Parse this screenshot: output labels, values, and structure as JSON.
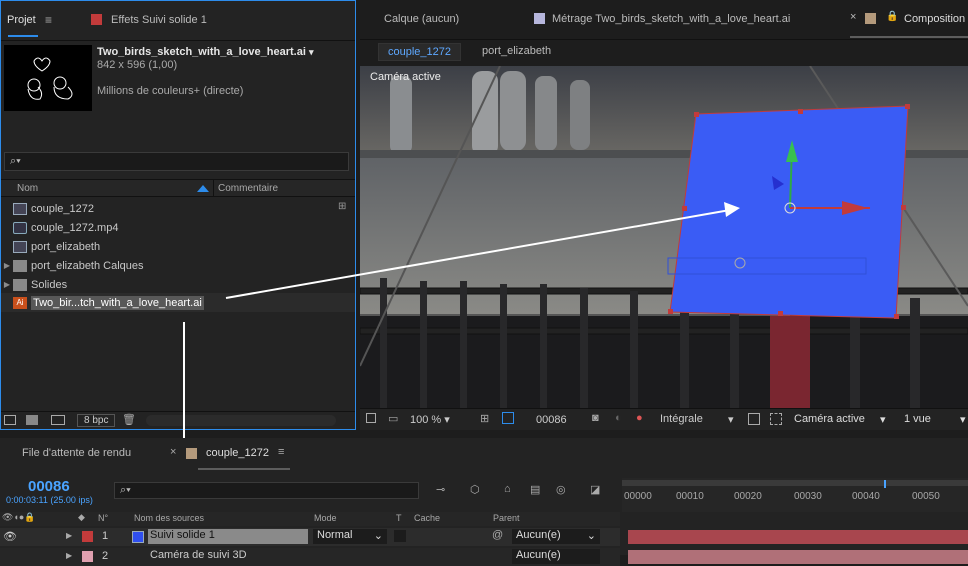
{
  "project_panel": {
    "tab_project": "Projet",
    "tab_effects": "Effets",
    "effects_target": "Suivi solide 1",
    "preview": {
      "name": "Two_birds_sketch_with_a_love_heart.ai",
      "dims": "842 x 596 (1,00)",
      "colors": "Millions de couleurs+ (directe)"
    },
    "search_placeholder": "",
    "col_name": "Nom",
    "col_comment": "Commentaire",
    "items": [
      {
        "label": "couple_1272",
        "kind": "comp"
      },
      {
        "label": "couple_1272.mp4",
        "kind": "footage"
      },
      {
        "label": "port_elizabeth",
        "kind": "comp"
      },
      {
        "label": "port_elizabeth Calques",
        "kind": "folder"
      },
      {
        "label": "Solides",
        "kind": "folder"
      },
      {
        "label": "Two_bir...tch_with_a_love_heart.ai",
        "kind": "ai"
      }
    ],
    "bpc": "8 bpc"
  },
  "viewer_panel": {
    "tab_layer": "Calque",
    "tab_layer_value": "(aucun)",
    "tab_footage": "Métrage",
    "tab_footage_value": "Two_birds_sketch_with_a_love_heart.ai",
    "tab_comp": "Composition",
    "comp_tabs": [
      "couple_1272",
      "port_elizabeth"
    ],
    "camera_label": "Caméra active",
    "zoom": "100 %",
    "timecode": "00086",
    "resolution": "Intégrale",
    "camera_select": "Caméra active",
    "views": "1 vue"
  },
  "timeline": {
    "tab_render": "File d'attente de rendu",
    "tab_comp": "couple_1272",
    "current_time": "00086",
    "current_time_sub": "0:00:03:11 (25.00 ips)",
    "ruler": [
      "00000",
      "00010",
      "00020",
      "00030",
      "00040",
      "00050"
    ],
    "columns": {
      "num": "N°",
      "name": "Nom des sources",
      "mode": "Mode",
      "t": "T",
      "matte": "Cache",
      "parent": "Parent"
    },
    "layers": [
      {
        "num": "1",
        "name": "Suivi solide 1",
        "mode": "Normal",
        "parent": "Aucun(e)",
        "color": "#2f4ff0"
      },
      {
        "num": "2",
        "name": "Caméra de suivi 3D",
        "mode": "",
        "parent": "Aucun(e)",
        "color": "#e0a0b0"
      }
    ]
  },
  "colors": {
    "accent": "#2d8ceb",
    "solid": "#3a5cf5",
    "label_red": "#c23b3b"
  }
}
